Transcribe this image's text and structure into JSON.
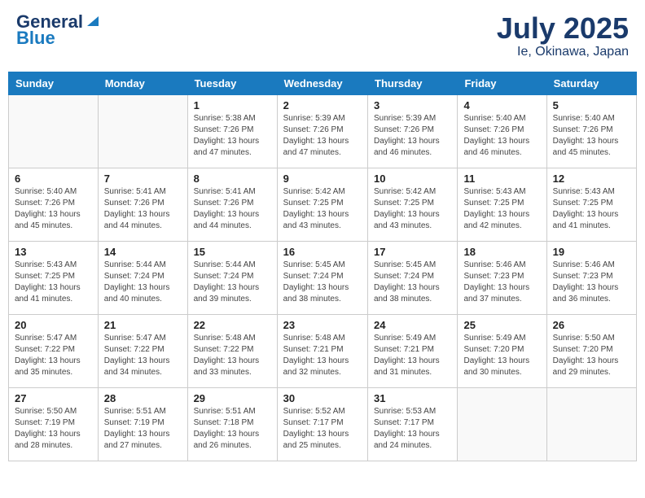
{
  "header": {
    "logo_general": "General",
    "logo_blue": "Blue",
    "month": "July 2025",
    "location": "Ie, Okinawa, Japan"
  },
  "days_of_week": [
    "Sunday",
    "Monday",
    "Tuesday",
    "Wednesday",
    "Thursday",
    "Friday",
    "Saturday"
  ],
  "weeks": [
    [
      {
        "day": "",
        "detail": ""
      },
      {
        "day": "",
        "detail": ""
      },
      {
        "day": "1",
        "detail": "Sunrise: 5:38 AM\nSunset: 7:26 PM\nDaylight: 13 hours and 47 minutes."
      },
      {
        "day": "2",
        "detail": "Sunrise: 5:39 AM\nSunset: 7:26 PM\nDaylight: 13 hours and 47 minutes."
      },
      {
        "day": "3",
        "detail": "Sunrise: 5:39 AM\nSunset: 7:26 PM\nDaylight: 13 hours and 46 minutes."
      },
      {
        "day": "4",
        "detail": "Sunrise: 5:40 AM\nSunset: 7:26 PM\nDaylight: 13 hours and 46 minutes."
      },
      {
        "day": "5",
        "detail": "Sunrise: 5:40 AM\nSunset: 7:26 PM\nDaylight: 13 hours and 45 minutes."
      }
    ],
    [
      {
        "day": "6",
        "detail": "Sunrise: 5:40 AM\nSunset: 7:26 PM\nDaylight: 13 hours and 45 minutes."
      },
      {
        "day": "7",
        "detail": "Sunrise: 5:41 AM\nSunset: 7:26 PM\nDaylight: 13 hours and 44 minutes."
      },
      {
        "day": "8",
        "detail": "Sunrise: 5:41 AM\nSunset: 7:26 PM\nDaylight: 13 hours and 44 minutes."
      },
      {
        "day": "9",
        "detail": "Sunrise: 5:42 AM\nSunset: 7:25 PM\nDaylight: 13 hours and 43 minutes."
      },
      {
        "day": "10",
        "detail": "Sunrise: 5:42 AM\nSunset: 7:25 PM\nDaylight: 13 hours and 43 minutes."
      },
      {
        "day": "11",
        "detail": "Sunrise: 5:43 AM\nSunset: 7:25 PM\nDaylight: 13 hours and 42 minutes."
      },
      {
        "day": "12",
        "detail": "Sunrise: 5:43 AM\nSunset: 7:25 PM\nDaylight: 13 hours and 41 minutes."
      }
    ],
    [
      {
        "day": "13",
        "detail": "Sunrise: 5:43 AM\nSunset: 7:25 PM\nDaylight: 13 hours and 41 minutes."
      },
      {
        "day": "14",
        "detail": "Sunrise: 5:44 AM\nSunset: 7:24 PM\nDaylight: 13 hours and 40 minutes."
      },
      {
        "day": "15",
        "detail": "Sunrise: 5:44 AM\nSunset: 7:24 PM\nDaylight: 13 hours and 39 minutes."
      },
      {
        "day": "16",
        "detail": "Sunrise: 5:45 AM\nSunset: 7:24 PM\nDaylight: 13 hours and 38 minutes."
      },
      {
        "day": "17",
        "detail": "Sunrise: 5:45 AM\nSunset: 7:24 PM\nDaylight: 13 hours and 38 minutes."
      },
      {
        "day": "18",
        "detail": "Sunrise: 5:46 AM\nSunset: 7:23 PM\nDaylight: 13 hours and 37 minutes."
      },
      {
        "day": "19",
        "detail": "Sunrise: 5:46 AM\nSunset: 7:23 PM\nDaylight: 13 hours and 36 minutes."
      }
    ],
    [
      {
        "day": "20",
        "detail": "Sunrise: 5:47 AM\nSunset: 7:22 PM\nDaylight: 13 hours and 35 minutes."
      },
      {
        "day": "21",
        "detail": "Sunrise: 5:47 AM\nSunset: 7:22 PM\nDaylight: 13 hours and 34 minutes."
      },
      {
        "day": "22",
        "detail": "Sunrise: 5:48 AM\nSunset: 7:22 PM\nDaylight: 13 hours and 33 minutes."
      },
      {
        "day": "23",
        "detail": "Sunrise: 5:48 AM\nSunset: 7:21 PM\nDaylight: 13 hours and 32 minutes."
      },
      {
        "day": "24",
        "detail": "Sunrise: 5:49 AM\nSunset: 7:21 PM\nDaylight: 13 hours and 31 minutes."
      },
      {
        "day": "25",
        "detail": "Sunrise: 5:49 AM\nSunset: 7:20 PM\nDaylight: 13 hours and 30 minutes."
      },
      {
        "day": "26",
        "detail": "Sunrise: 5:50 AM\nSunset: 7:20 PM\nDaylight: 13 hours and 29 minutes."
      }
    ],
    [
      {
        "day": "27",
        "detail": "Sunrise: 5:50 AM\nSunset: 7:19 PM\nDaylight: 13 hours and 28 minutes."
      },
      {
        "day": "28",
        "detail": "Sunrise: 5:51 AM\nSunset: 7:19 PM\nDaylight: 13 hours and 27 minutes."
      },
      {
        "day": "29",
        "detail": "Sunrise: 5:51 AM\nSunset: 7:18 PM\nDaylight: 13 hours and 26 minutes."
      },
      {
        "day": "30",
        "detail": "Sunrise: 5:52 AM\nSunset: 7:17 PM\nDaylight: 13 hours and 25 minutes."
      },
      {
        "day": "31",
        "detail": "Sunrise: 5:53 AM\nSunset: 7:17 PM\nDaylight: 13 hours and 24 minutes."
      },
      {
        "day": "",
        "detail": ""
      },
      {
        "day": "",
        "detail": ""
      }
    ]
  ]
}
